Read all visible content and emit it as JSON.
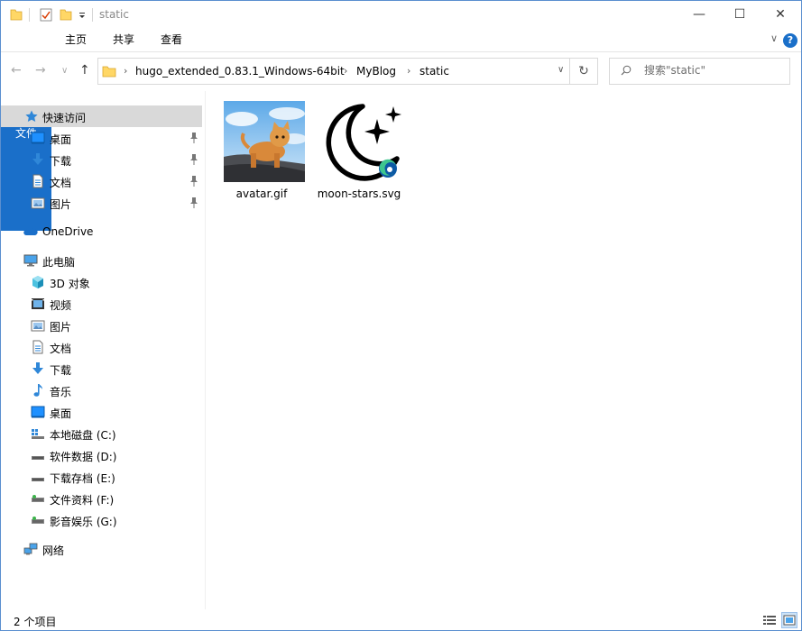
{
  "window": {
    "title": "static"
  },
  "window_controls": {
    "minimize": "—",
    "maximize": "☐",
    "close": "✕"
  },
  "ribbon": {
    "tabs": [
      "文件",
      "主页",
      "共享",
      "查看"
    ],
    "help": "?",
    "expand_chevron": "∨"
  },
  "address": {
    "breadcrumbs": [
      "hugo_extended_0.83.1_Windows-64bit",
      "MyBlog",
      "static"
    ],
    "search_placeholder": "搜索\"static\""
  },
  "nav": {
    "quick_access": {
      "label": "快速访问",
      "items": [
        {
          "label": "桌面",
          "icon": "desktop-icon",
          "pinned": true
        },
        {
          "label": "下载",
          "icon": "download-icon",
          "pinned": true
        },
        {
          "label": "文档",
          "icon": "documents-icon",
          "pinned": true
        },
        {
          "label": "图片",
          "icon": "pictures-icon",
          "pinned": true
        }
      ]
    },
    "onedrive": {
      "label": "OneDrive",
      "icon": "onedrive-icon"
    },
    "this_pc": {
      "label": "此电脑",
      "items": [
        {
          "label": "3D 对象",
          "icon": "3d-objects-icon"
        },
        {
          "label": "视频",
          "icon": "videos-icon"
        },
        {
          "label": "图片",
          "icon": "pictures-icon"
        },
        {
          "label": "文档",
          "icon": "documents-icon"
        },
        {
          "label": "下载",
          "icon": "download-icon"
        },
        {
          "label": "音乐",
          "icon": "music-icon"
        },
        {
          "label": "桌面",
          "icon": "desktop-icon"
        },
        {
          "label": "本地磁盘 (C:)",
          "icon": "system-drive-icon"
        },
        {
          "label": "软件数据 (D:)",
          "icon": "drive-icon"
        },
        {
          "label": "下载存档 (E:)",
          "icon": "drive-icon"
        },
        {
          "label": "文件资料 (F:)",
          "icon": "network-drive-icon"
        },
        {
          "label": "影音娱乐 (G:)",
          "icon": "network-drive-icon"
        }
      ]
    },
    "network": {
      "label": "网络",
      "icon": "network-icon"
    }
  },
  "files": [
    {
      "name": "avatar.gif",
      "icon": "cat-photo-thumbnail"
    },
    {
      "name": "moon-stars.svg",
      "icon": "moon-stars-edge-icon"
    }
  ],
  "status": {
    "item_count": "2 个项目"
  },
  "colors": {
    "accent": "#1a6fc9",
    "selected_nav": "#d9d9d9",
    "folder": "#ffd766"
  }
}
